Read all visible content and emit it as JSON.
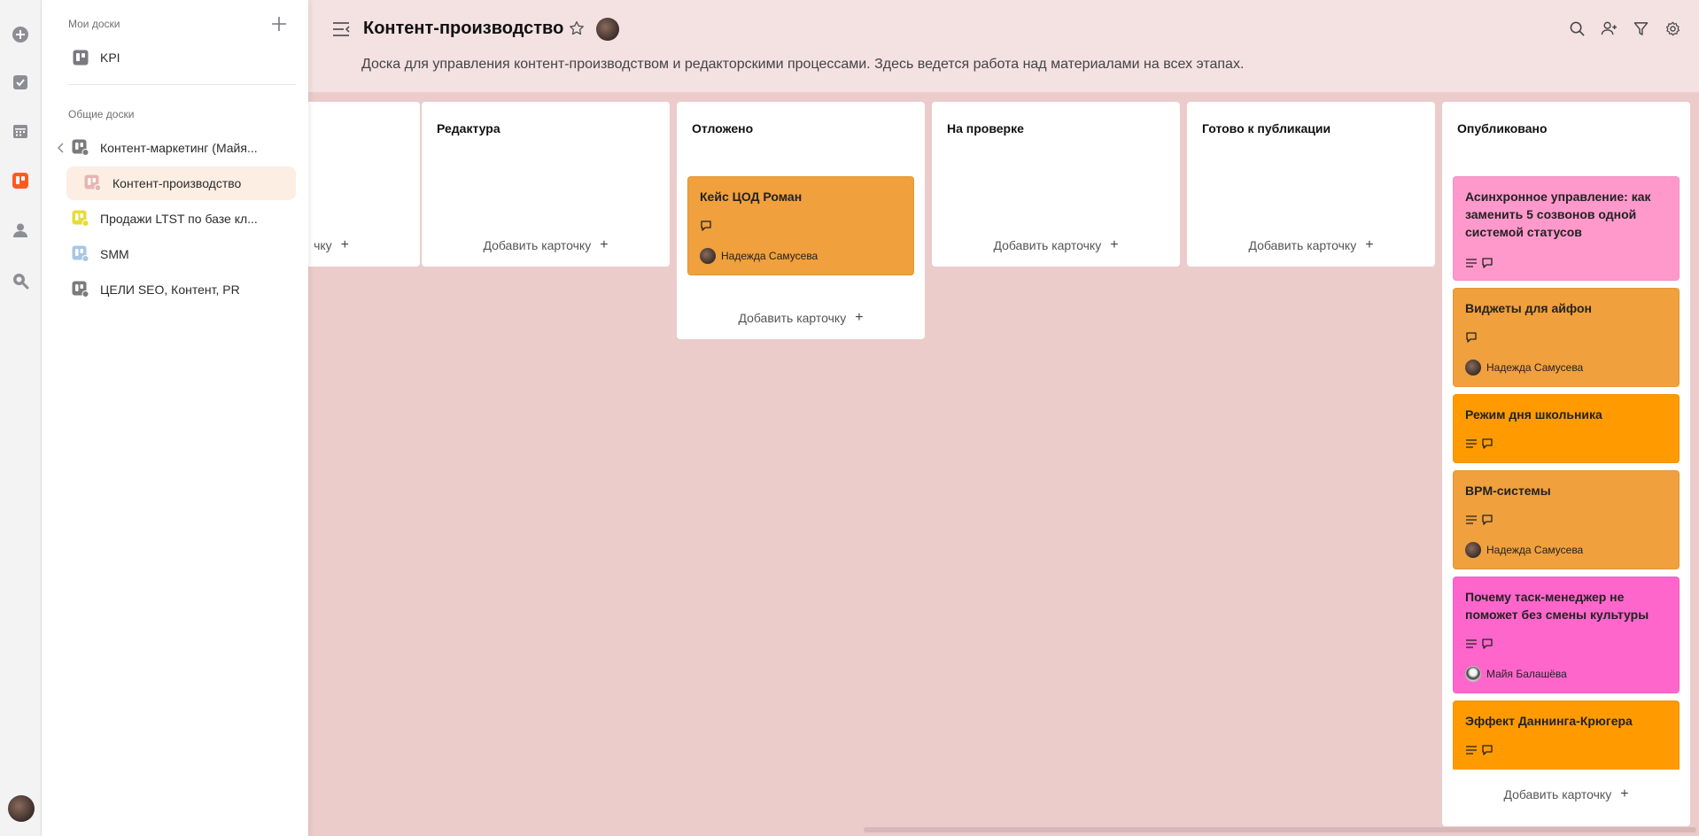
{
  "sidebar": {
    "my_boards_title": "Мои доски",
    "my_boards": [
      {
        "label": "KPI",
        "icon": "board-icon",
        "color": "#7a7a80"
      }
    ],
    "shared_boards_title": "Общие доски",
    "shared_boards": [
      {
        "label": "Контент-маркетинг (Майя...",
        "icon": "board-icon",
        "color": "#7a7a80"
      },
      {
        "label": "Контент-производство",
        "icon": "board-icon",
        "color": "#e8b5b0",
        "active": true
      },
      {
        "label": "Продажи LTST по базе кл...",
        "icon": "board-icon",
        "color": "#e6dc3a"
      },
      {
        "label": "SMM",
        "icon": "board-icon",
        "color": "#a8c7e6"
      },
      {
        "label": "ЦЕЛИ SEO, Контент, PR",
        "icon": "board-icon",
        "color": "#7a7a80"
      }
    ]
  },
  "header": {
    "title": "Контент-производство",
    "description": "Доска для управления контент-производством и редакторскими процессами. Здесь ведется работа над материалами на всех этапах."
  },
  "add_card_label": "Добавить карточку",
  "columns": [
    {
      "title": "",
      "add_label": "чку"
    },
    {
      "title": "Редактура"
    },
    {
      "title": "Отложено"
    },
    {
      "title": "На проверке"
    },
    {
      "title": "Готово к публикации"
    },
    {
      "title": "Опубликовано"
    }
  ],
  "cards": {
    "postponed": [
      {
        "title": "Кейс ЦОД Роман",
        "assignee": "Надежда Самусева",
        "color": "#f0a03c"
      }
    ],
    "published": [
      {
        "title": "Асинхронное управление: как заменить 5 созвонов одной системой статусов",
        "color": "#ff99cc"
      },
      {
        "title": "Виджеты для айфон",
        "assignee": "Надежда Самусева",
        "color": "#f0a03c"
      },
      {
        "title": "Режим дня школьника",
        "color": "#ff9b00"
      },
      {
        "title": "BPM-системы",
        "assignee": "Надежда Самусева",
        "color": "#f0a03c"
      },
      {
        "title": "Почему таск-менеджер не поможет без смены культуры",
        "assignee": "Майя Балашёва",
        "color": "#ff66cc"
      },
      {
        "title": "Эффект Даннинга-Крюгера",
        "color": "#ff9b00"
      }
    ]
  },
  "colors": {
    "board_bg": "#ebcccb",
    "header_bg": "#f4e1e1",
    "accent": "#ff5a1f"
  }
}
